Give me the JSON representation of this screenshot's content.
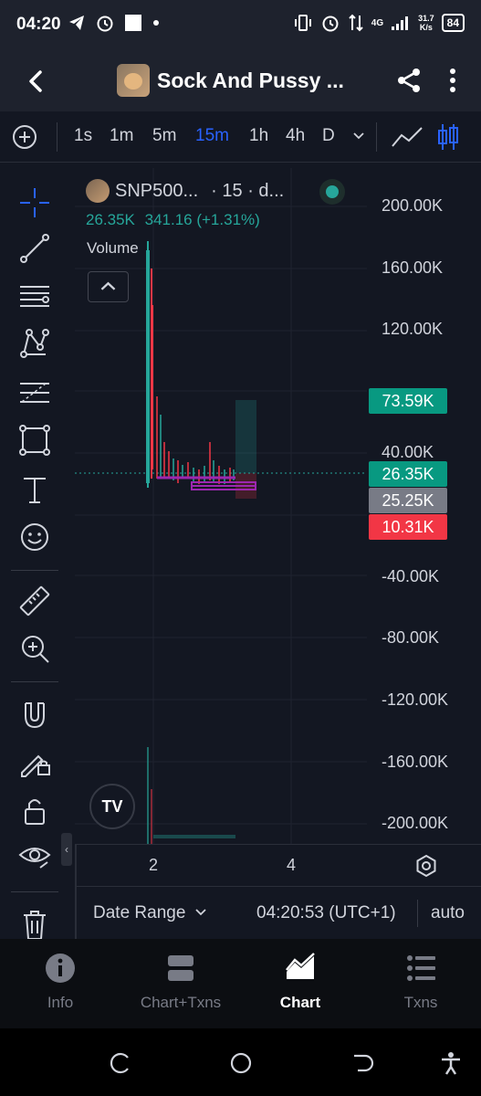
{
  "status_bar": {
    "time": "04:20",
    "net_speed_value": "31.7",
    "net_speed_unit": "K/s",
    "network": "4G",
    "battery": "84"
  },
  "header": {
    "title": "Sock And Pussy ..."
  },
  "timeframes": {
    "items": [
      "1s",
      "1m",
      "5m",
      "15m",
      "1h",
      "4h",
      "D"
    ],
    "active": "15m"
  },
  "legend": {
    "symbol": "SNP500...",
    "interval": "· 15 · d...",
    "price": "26.35K",
    "change": "341.16 (+1.31%)",
    "volume_label": "Volume"
  },
  "price_axis": {
    "labels": [
      "200.00K",
      "160.00K",
      "120.00K",
      "40.00K",
      "-40.00K",
      "-80.00K",
      "-120.00K",
      "-160.00K",
      "-200.00K"
    ],
    "tags": [
      {
        "value": "73.59K",
        "color": "#089981"
      },
      {
        "value": "26.35K",
        "color": "#089981"
      },
      {
        "value": "25.25K",
        "color": "#787b86"
      },
      {
        "value": "10.31K",
        "color": "#f23645"
      }
    ]
  },
  "time_axis": {
    "labels": [
      "2",
      "4"
    ]
  },
  "bottom_bar": {
    "date_range": "Date Range",
    "clock": "04:20:53 (UTC+1)",
    "scale_mode": "auto"
  },
  "tabs": [
    {
      "label": "Info",
      "icon": "info-icon"
    },
    {
      "label": "Chart+Txns",
      "icon": "split-view-icon"
    },
    {
      "label": "Chart",
      "icon": "area-chart-icon"
    },
    {
      "label": "Txns",
      "icon": "list-icon"
    }
  ],
  "active_tab": "Chart",
  "colors": {
    "background": "#131722",
    "accent": "#2962ff",
    "up": "#26a69a",
    "down": "#f23645",
    "position_line": "#9c27b0"
  }
}
